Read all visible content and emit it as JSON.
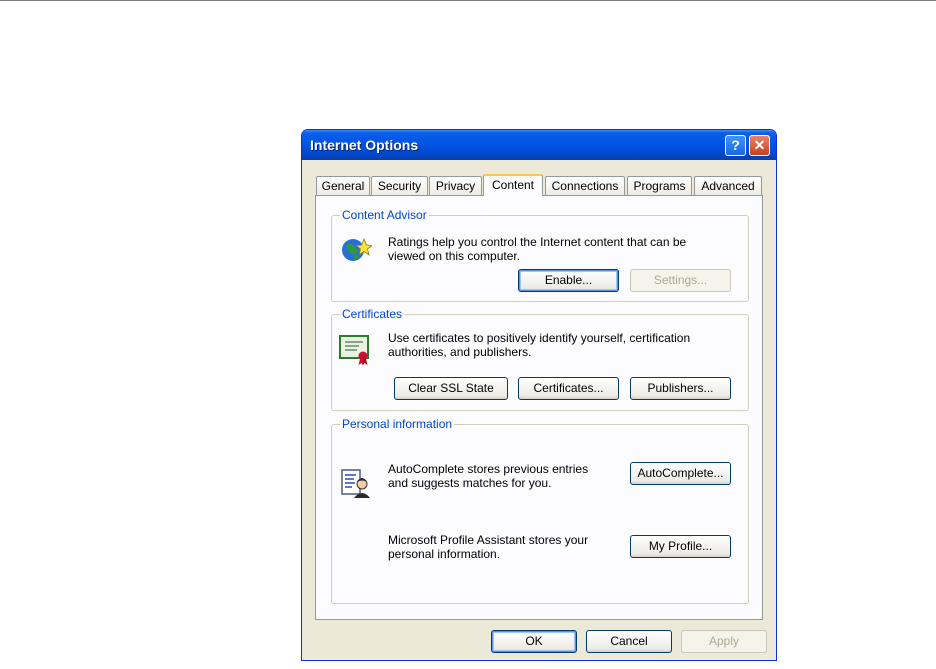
{
  "window": {
    "title": "Internet Options",
    "help_glyph": "?",
    "close_glyph": "✕"
  },
  "tabs": [
    "General",
    "Security",
    "Privacy",
    "Content",
    "Connections",
    "Programs",
    "Advanced"
  ],
  "active_tab": "Content",
  "content_advisor": {
    "legend": "Content Advisor",
    "text_line1": "Ratings help you control the Internet content that can be",
    "text_line2": "viewed on this computer.",
    "enable_button": "Enable...",
    "settings_button": "Settings..."
  },
  "certificates": {
    "legend": "Certificates",
    "text_line1": "Use certificates to positively identify yourself, certification",
    "text_line2": "authorities, and publishers.",
    "clear_ssl_button": "Clear SSL State",
    "certificates_button": "Certificates...",
    "publishers_button": "Publishers..."
  },
  "personal_information": {
    "legend": "Personal information",
    "autocomplete_line1": "AutoComplete stores previous entries",
    "autocomplete_line2": "and suggests matches for you.",
    "autocomplete_button": "AutoComplete...",
    "profile_line1": "Microsoft Profile Assistant stores your",
    "profile_line2": "personal information.",
    "my_profile_button": "My Profile..."
  },
  "footer": {
    "ok_button": "OK",
    "cancel_button": "Cancel",
    "apply_button": "Apply"
  },
  "colors": {
    "title_bar": "#0054e3",
    "legend_text": "#0046d5",
    "dialog_bg": "#ece9d8",
    "active_tab_highlight": "#ffc83c"
  }
}
